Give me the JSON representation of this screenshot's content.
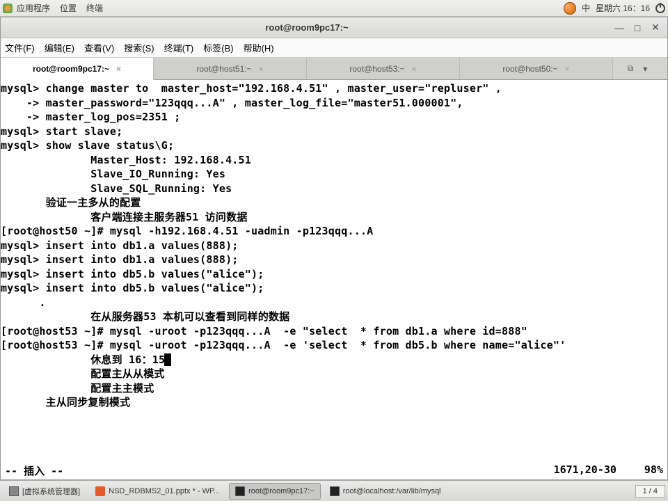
{
  "panel": {
    "menu": [
      "应用程序",
      "位置",
      "终端"
    ],
    "ime": "中",
    "clock": "星期六 16：16"
  },
  "window": {
    "title": "root@room9pc17:~",
    "menus": [
      "文件(F)",
      "编辑(E)",
      "查看(V)",
      "搜索(S)",
      "终端(T)",
      "标签(B)",
      "帮助(H)"
    ],
    "tabs": [
      {
        "label": "root@room9pc17:~",
        "active": true
      },
      {
        "label": "root@host51:~",
        "active": false
      },
      {
        "label": "root@host53:~",
        "active": false
      },
      {
        "label": "root@host50:~",
        "active": false
      }
    ]
  },
  "terminal_lines": [
    "mysql> change master to  master_host=\"192.168.4.51\" , master_user=\"repluser\" ,",
    "    -> master_password=\"123qqq...A\" , master_log_file=\"master51.000001\",",
    "    -> master_log_pos=2351 ;",
    "mysql> start slave;",
    "mysql> show slave status\\G;",
    "              Master_Host: 192.168.4.51",
    "              Slave_IO_Running: Yes",
    "              Slave_SQL_Running: Yes",
    "",
    "       验证一主多从的配置",
    "              客户端连接主服务器51 访问数据",
    "[root@host50 ~]# mysql -h192.168.4.51 -uadmin -p123qqq...A",
    "mysql> insert into db1.a values(888);",
    "mysql> insert into db1.a values(888);",
    "mysql> insert into db5.b values(\"alice\");",
    "mysql> insert into db5.b values(\"alice\");",
    "      .",
    "              在从服务器53 本机可以查看到同样的数据",
    "[root@host53 ~]# mysql -uroot -p123qqq...A  -e \"select  * from db1.a where id=888\"",
    "[root@host53 ~]# mysql -uroot -p123qqq...A  -e 'select  * from db5.b where name=\"alice\"'"
  ],
  "terminal_cursor_line": "              休息到 16：15",
  "terminal_tail": [
    "",
    "",
    "              配置主从从模式",
    "              配置主主模式",
    "       主从同步复制模式"
  ],
  "status": {
    "mode": "-- 插入 --",
    "pos": "1671,20-30",
    "pct": "98%"
  },
  "taskbar": {
    "items": [
      {
        "icon": "vm",
        "label": "[虚拟系统管理器]",
        "active": false
      },
      {
        "icon": "wps",
        "label": "NSD_RDBMS2_01.pptx * - WP...",
        "active": false
      },
      {
        "icon": "term",
        "label": "root@room9pc17:~",
        "active": true
      },
      {
        "icon": "term",
        "label": "root@localhost:/var/lib/mysql",
        "active": false
      }
    ],
    "workspace": "1 / 4"
  }
}
